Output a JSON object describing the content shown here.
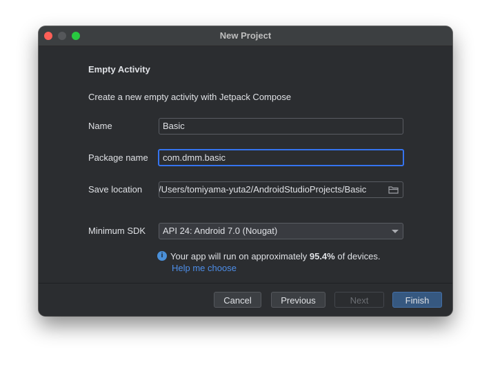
{
  "window": {
    "title": "New Project"
  },
  "form": {
    "heading": "Empty Activity",
    "description": "Create a new empty activity with Jetpack Compose",
    "name_label": "Name",
    "name_value": "Basic",
    "package_label": "Package name",
    "package_value": "com.dmm.basic",
    "save_label": "Save location",
    "save_value": "/Users/tomiyama-yuta2/AndroidStudioProjects/Basic",
    "sdk_label": "Minimum SDK",
    "sdk_value": "API 24: Android 7.0 (Nougat)"
  },
  "info": {
    "prefix": "Your app will run on approximately ",
    "percent": "95.4%",
    "suffix": " of devices.",
    "link": "Help me choose"
  },
  "buttons": {
    "cancel": "Cancel",
    "previous": "Previous",
    "next": "Next",
    "finish": "Finish"
  },
  "colors": {
    "accent": "#3574f0",
    "link": "#4d8ee9",
    "primary_button": "#365880",
    "background": "#2b2d30"
  },
  "icons": [
    "close-icon",
    "minimize-icon",
    "maximize-icon",
    "folder-icon",
    "chevron-down-icon",
    "info-icon"
  ]
}
